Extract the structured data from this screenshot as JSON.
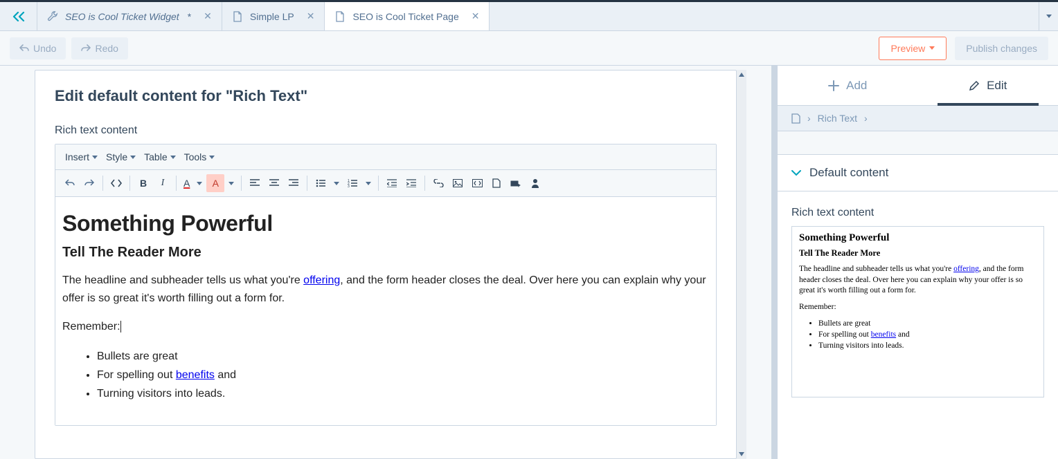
{
  "tabs": [
    {
      "label": "SEO is Cool Ticket Widget",
      "dirty": true,
      "icon": "wrench"
    },
    {
      "label": "Simple LP",
      "dirty": false,
      "icon": "page"
    },
    {
      "label": "SEO is Cool Ticket Page",
      "dirty": false,
      "icon": "page",
      "active": true
    }
  ],
  "actions": {
    "undo": "Undo",
    "redo": "Redo",
    "preview": "Preview",
    "publish": "Publish changes"
  },
  "editor": {
    "title": "Edit default content for \"Rich Text\"",
    "section_label": "Rich text content",
    "menubar": [
      "Insert",
      "Style",
      "Table",
      "Tools"
    ],
    "content": {
      "h1": "Something Powerful",
      "h2": "Tell The Reader More",
      "p1_a": "The headline and subheader tells us what you're ",
      "p1_link": "offering",
      "p1_b": ", and the form header closes the deal. Over here you can explain why your offer is so great it's worth filling out a form for.",
      "p2": "Remember:",
      "bullets": {
        "b1": "Bullets are great",
        "b2_a": "For spelling out ",
        "b2_link": "benefits",
        "b2_b": " and",
        "b3": "Turning visitors into leads."
      }
    }
  },
  "sidebar": {
    "tabs": {
      "add": "Add",
      "edit": "Edit"
    },
    "breadcrumb": {
      "item": "Rich Text"
    },
    "accordion": {
      "default_content": "Default content"
    },
    "panel_label": "Rich text content"
  }
}
